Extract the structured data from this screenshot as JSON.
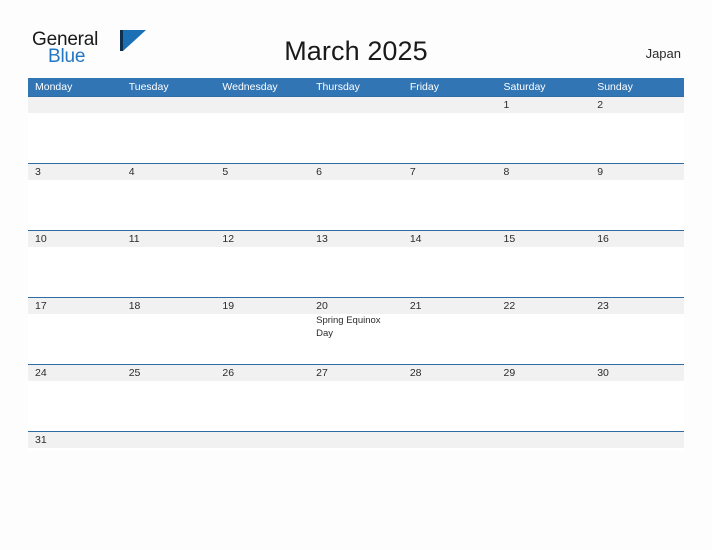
{
  "brand": {
    "word_one": "General",
    "word_two": "Blue",
    "mark_icon": "triangle-flag-icon",
    "accent_dark": "#0f2f4f",
    "accent_blue": "#1b6fb5",
    "text_blue": "#2277c4"
  },
  "header": {
    "title": "March 2025",
    "region": "Japan"
  },
  "theme": {
    "header_blue": "#3275b5",
    "row_border": "#2e6da4",
    "band_gray": "#f1f1f1",
    "page_background": "#fdfdfd",
    "text": "#2b2b2b"
  },
  "calendar": {
    "month": "March",
    "year": "2025",
    "day_headers": [
      "Monday",
      "Tuesday",
      "Wednesday",
      "Thursday",
      "Friday",
      "Saturday",
      "Sunday"
    ],
    "weeks": [
      {
        "days": [
          {
            "num": "",
            "events": []
          },
          {
            "num": "",
            "events": []
          },
          {
            "num": "",
            "events": []
          },
          {
            "num": "",
            "events": []
          },
          {
            "num": "",
            "events": []
          },
          {
            "num": "1",
            "events": []
          },
          {
            "num": "2",
            "events": []
          }
        ]
      },
      {
        "days": [
          {
            "num": "3",
            "events": []
          },
          {
            "num": "4",
            "events": []
          },
          {
            "num": "5",
            "events": []
          },
          {
            "num": "6",
            "events": []
          },
          {
            "num": "7",
            "events": []
          },
          {
            "num": "8",
            "events": []
          },
          {
            "num": "9",
            "events": []
          }
        ]
      },
      {
        "days": [
          {
            "num": "10",
            "events": []
          },
          {
            "num": "11",
            "events": []
          },
          {
            "num": "12",
            "events": []
          },
          {
            "num": "13",
            "events": []
          },
          {
            "num": "14",
            "events": []
          },
          {
            "num": "15",
            "events": []
          },
          {
            "num": "16",
            "events": []
          }
        ]
      },
      {
        "days": [
          {
            "num": "17",
            "events": []
          },
          {
            "num": "18",
            "events": []
          },
          {
            "num": "19",
            "events": []
          },
          {
            "num": "20",
            "events": [
              "Spring Equinox Day"
            ]
          },
          {
            "num": "21",
            "events": []
          },
          {
            "num": "22",
            "events": []
          },
          {
            "num": "23",
            "events": []
          }
        ]
      },
      {
        "days": [
          {
            "num": "24",
            "events": []
          },
          {
            "num": "25",
            "events": []
          },
          {
            "num": "26",
            "events": []
          },
          {
            "num": "27",
            "events": []
          },
          {
            "num": "28",
            "events": []
          },
          {
            "num": "29",
            "events": []
          },
          {
            "num": "30",
            "events": []
          }
        ]
      },
      {
        "days": [
          {
            "num": "31",
            "events": []
          },
          {
            "num": "",
            "events": []
          },
          {
            "num": "",
            "events": []
          },
          {
            "num": "",
            "events": []
          },
          {
            "num": "",
            "events": []
          },
          {
            "num": "",
            "events": []
          },
          {
            "num": "",
            "events": []
          }
        ]
      }
    ]
  }
}
